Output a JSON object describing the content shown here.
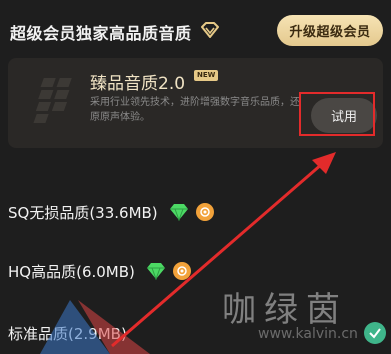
{
  "header": {
    "title": "超级会员独家高品质音质",
    "upgrade_label": "升级超级会员"
  },
  "premium_card": {
    "title": "臻品音质2.0",
    "badge": "NEW",
    "description": "采用行业领先技术，进阶增强数字音乐品质，还原原声体验。",
    "trial_label": "试用"
  },
  "quality_options": [
    {
      "label": "SQ无损品质(33.6MB)",
      "icons": [
        "diamond-icon",
        "coin-icon"
      ]
    },
    {
      "label": "HQ高品质(6.0MB)",
      "icons": [
        "diamond-icon",
        "coin-icon"
      ]
    },
    {
      "label": "标准品质(2.9MB)",
      "icons": []
    }
  ],
  "watermark": {
    "text": "咖绿茵",
    "url": "www.kalvin.cn"
  },
  "colors": {
    "background": "#1e1e1e",
    "accent_gold": "#e6c987",
    "annotation_red": "#e32b2b",
    "gem_green": "#4cd964",
    "coin_orange": "#f2a23a",
    "check_green": "#3fb58a"
  }
}
